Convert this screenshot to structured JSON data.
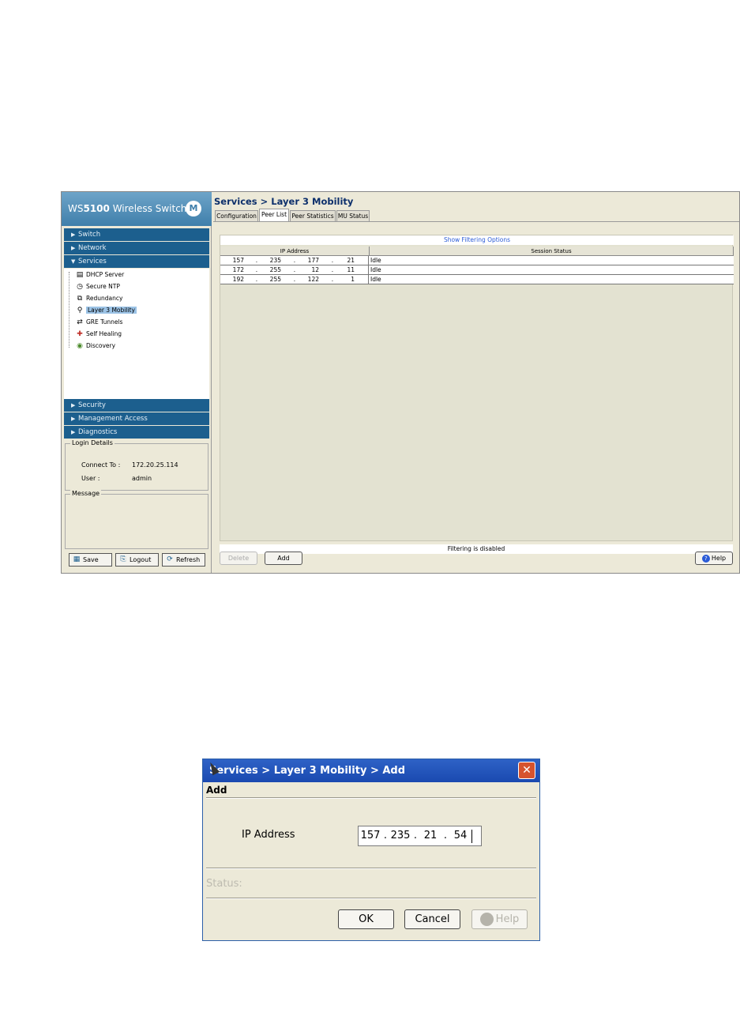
{
  "main": {
    "brand": {
      "prefix": "WS",
      "model": "5100",
      "suffix": " Wireless Switch",
      "logo": "M"
    },
    "nav": {
      "switch": "Switch",
      "network": "Network",
      "services": "Services",
      "security": "Security",
      "management": "Management Access",
      "diagnostics": "Diagnostics"
    },
    "tree": [
      {
        "label": "DHCP Server",
        "icon": "server-icon"
      },
      {
        "label": "Secure NTP",
        "icon": "clock-icon"
      },
      {
        "label": "Redundancy",
        "icon": "redundancy-icon"
      },
      {
        "label": "Layer 3 Mobility",
        "icon": "mobility-icon",
        "selected": true
      },
      {
        "label": "GRE Tunnels",
        "icon": "tunnel-icon"
      },
      {
        "label": "Self Healing",
        "icon": "healing-icon"
      },
      {
        "label": "Discovery",
        "icon": "discovery-icon"
      }
    ],
    "login": {
      "legend": "Login Details",
      "connect_label": "Connect To :",
      "connect_value": "172.20.25.114",
      "user_label": "User :",
      "user_value": "admin"
    },
    "message_legend": "Message",
    "buttons": {
      "save": "Save",
      "logout": "Logout",
      "refresh": "Refresh"
    },
    "page_title": "Services > Layer 3 Mobility",
    "tabs": [
      "Configuration",
      "Peer List",
      "Peer Statistics",
      "MU Status"
    ],
    "active_tab": 1,
    "filter_link": "Show Filtering Options",
    "table": {
      "headers": [
        "IP Address",
        "Session Status"
      ],
      "rows": [
        {
          "ip": [
            "157",
            "235",
            "177",
            "21"
          ],
          "status": "Idle"
        },
        {
          "ip": [
            "172",
            "255",
            "12",
            "11"
          ],
          "status": "Idle"
        },
        {
          "ip": [
            "192",
            "255",
            "122",
            "1"
          ],
          "status": "Idle"
        }
      ]
    },
    "filter_status": "Filtering is disabled",
    "actions": {
      "delete": "Delete",
      "add": "Add",
      "help": "Help"
    }
  },
  "dialog": {
    "title": "Services > Layer 3 Mobility > Add",
    "heading": "Add",
    "ip_label": "IP Address",
    "ip_value": [
      "157",
      "235",
      "21",
      "54"
    ],
    "status_label": "Status:",
    "buttons": {
      "ok": "OK",
      "cancel": "Cancel",
      "help": "Help"
    }
  },
  "colors": {
    "nav_bg": "#1c5f8e",
    "brand_bg": "#3f7fab",
    "dialog_title": "#1a49b0",
    "link": "#2a5bd7"
  }
}
